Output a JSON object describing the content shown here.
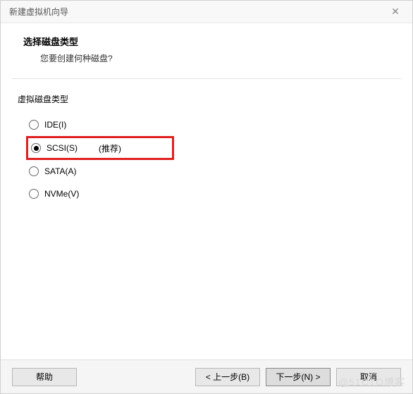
{
  "window": {
    "title": "新建虚拟机向导"
  },
  "header": {
    "title": "选择磁盘类型",
    "subtitle": "您要创建何种磁盘?"
  },
  "group": {
    "label": "虚拟磁盘类型"
  },
  "options": {
    "ide": {
      "label": "IDE(I)"
    },
    "scsi": {
      "label": "SCSI(S)",
      "hint": "(推荐)"
    },
    "sata": {
      "label": "SATA(A)"
    },
    "nvme": {
      "label": "NVMe(V)"
    }
  },
  "buttons": {
    "help": "帮助",
    "back": "< 上一步(B)",
    "next": "下一步(N) >",
    "cancel": "取消"
  },
  "watermark": "@51CTO博客"
}
